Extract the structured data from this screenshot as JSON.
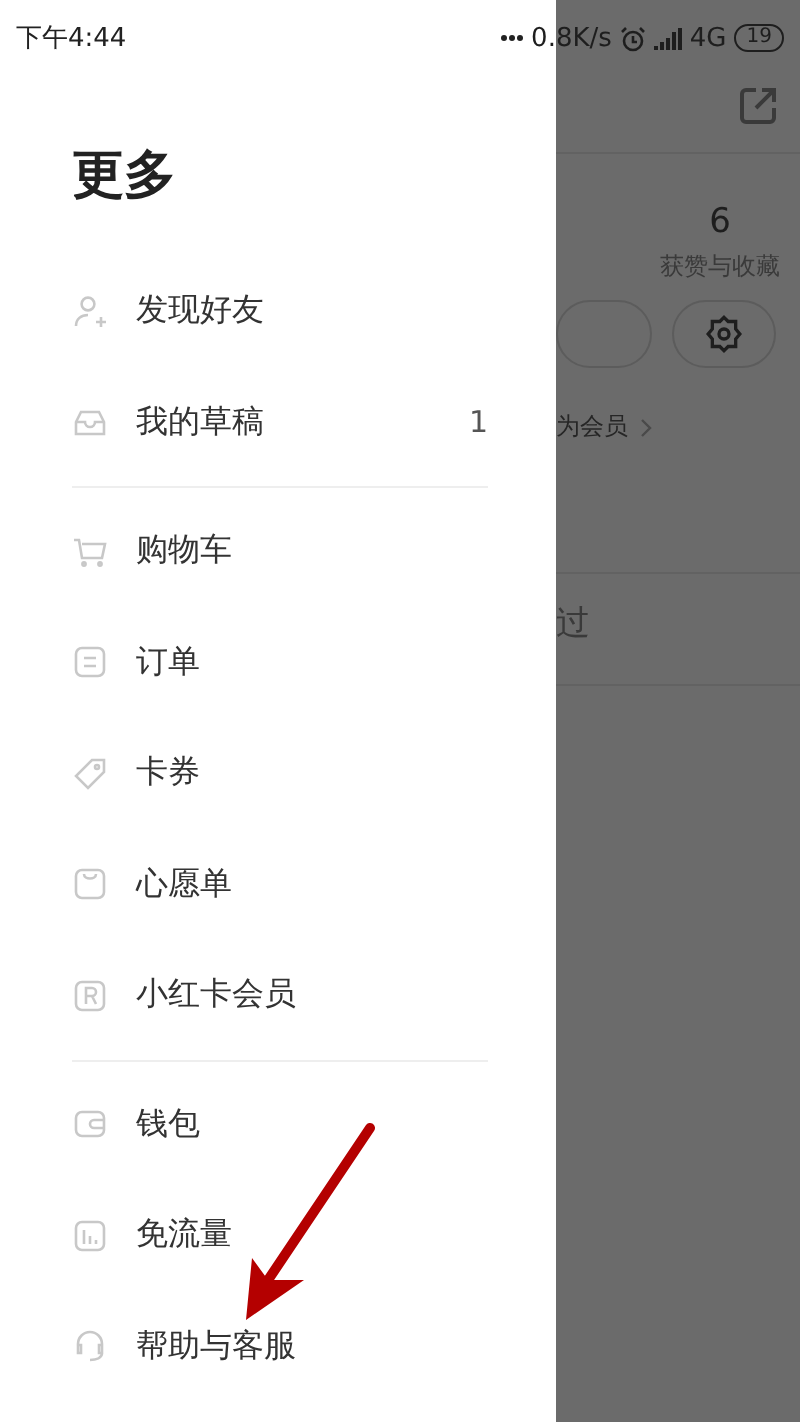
{
  "status_bar": {
    "time": "下午4:44",
    "network_speed": "0.8K/s",
    "network": "4G",
    "battery": "19"
  },
  "drawer": {
    "title": "更多",
    "sections": [
      [
        {
          "label": "发现好友"
        },
        {
          "label": "我的草稿",
          "count": "1"
        }
      ],
      [
        {
          "label": "购物车"
        },
        {
          "label": "订单"
        },
        {
          "label": "卡券"
        },
        {
          "label": "心愿单"
        },
        {
          "label": "小红卡会员"
        }
      ],
      [
        {
          "label": "钱包"
        },
        {
          "label": "免流量"
        },
        {
          "label": "帮助与客服"
        }
      ]
    ]
  },
  "background_page": {
    "stat_count": "6",
    "stat_label": "获赞与收藏",
    "member_link": "为会员",
    "list_item": "过"
  }
}
